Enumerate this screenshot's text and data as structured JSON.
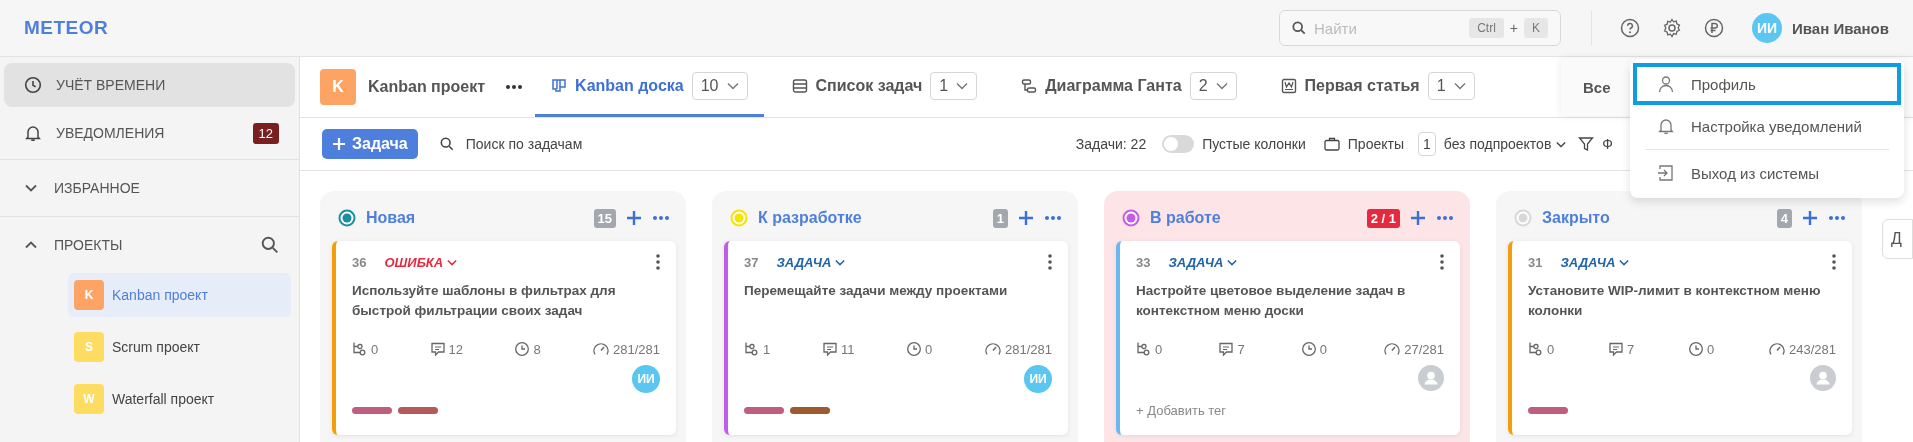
{
  "logo": "METEOR",
  "search": {
    "placeholder": "Найти",
    "keys": [
      "Ctrl",
      "+",
      "K"
    ]
  },
  "user": {
    "initials": "ИИ",
    "name": "Иван Иванов"
  },
  "sidebar": {
    "items": [
      {
        "label": "УЧЁТ ВРЕМЕНИ",
        "kind": "clock",
        "selected": true
      },
      {
        "label": "УВЕДОМЛЕНИЯ",
        "kind": "bell",
        "badge": "12",
        "selected": false
      }
    ],
    "sections": [
      {
        "label": "ИЗБРАННОЕ",
        "expanded": false,
        "searchable": false
      },
      {
        "label": "ПРОЕКТЫ",
        "expanded": true,
        "searchable": true,
        "projects": [
          {
            "letter": "K",
            "name": "Kanban проект",
            "color": "#fda465",
            "selected": true
          },
          {
            "letter": "S",
            "name": "Scrum проект",
            "color": "#fedc62",
            "selected": false
          },
          {
            "letter": "W",
            "name": "Waterfall проект",
            "color": "#fedc62",
            "selected": false
          }
        ]
      }
    ]
  },
  "project": {
    "letter": "K",
    "name": "Kanban проект",
    "color": "#fda465"
  },
  "tabs": [
    {
      "label": "Kanban доска",
      "kind": "board",
      "count": "10",
      "selected": true
    },
    {
      "label": "Список задач",
      "kind": "list",
      "count": "1",
      "selected": false
    },
    {
      "label": "Диаграмма Ганта",
      "kind": "gantt",
      "count": "2",
      "selected": false
    },
    {
      "label": "Первая статья",
      "kind": "article",
      "count": "1",
      "selected": false
    }
  ],
  "view_field": {
    "value": "Все"
  },
  "toolbar": {
    "add_button": "Задача",
    "search_placeholder": "Поиск по задачам",
    "tasks_count": "Задачи: 22",
    "empty_columns": {
      "label": "Пустые колонки",
      "on": false
    },
    "projects": {
      "label": "Проекты",
      "count": "1",
      "scope": "без подпроектов"
    },
    "filter_label": "Ф"
  },
  "user_menu": [
    {
      "label": "Профиль",
      "kind": "person",
      "selected": true
    },
    {
      "label": "Настройка уведомлений",
      "kind": "bell",
      "selected": false
    },
    {
      "label": "Выход из системы",
      "kind": "exit",
      "selected": false
    }
  ],
  "columns": [
    {
      "title": "Новая",
      "color": "#1a8fa0",
      "count": "15",
      "over_limit": false,
      "cards": [
        {
          "number": "36",
          "type": "ОШИБКА",
          "kind": "bug",
          "color": "#f59e0b",
          "title": "Используйте шаблоны в фильтрах для быстрой фильтрации своих задач",
          "subtasks": "0",
          "comments": "12",
          "time": "8",
          "estimate": "281/281",
          "assignee": {
            "kind": "initials",
            "initials": "ИИ"
          },
          "tags": [
            {
              "color": "#bf5f7d"
            },
            {
              "color": "#b45a5a"
            }
          ]
        }
      ]
    },
    {
      "title": "К разработке",
      "color": "#f5e400",
      "count": "1",
      "over_limit": false,
      "cards": [
        {
          "number": "37",
          "type": "ЗАДАЧА",
          "kind": "task",
          "color": "#c45ce8",
          "title": "Перемещайте задачи между проектами",
          "subtasks": "1",
          "comments": "11",
          "time": "0",
          "estimate": "281/281",
          "assignee": {
            "kind": "initials",
            "initials": "ИИ"
          },
          "tags": [
            {
              "color": "#bf5f7d"
            },
            {
              "color": "#9c5a2e"
            }
          ]
        }
      ]
    },
    {
      "title": "В работе",
      "color": "#c45ce8",
      "count": "2 / 1",
      "over_limit": true,
      "cards": [
        {
          "number": "33",
          "type": "ЗАДАЧА",
          "kind": "task",
          "color": "#6bb8f0",
          "title": "Настройте цветовое выделение задач в контекстном меню доски",
          "subtasks": "0",
          "comments": "7",
          "time": "0",
          "estimate": "27/281",
          "assignee": {
            "kind": "placeholder"
          },
          "add_tag": "+ Добавить тег"
        }
      ]
    },
    {
      "title": "Закрыто",
      "color": "#d8d8d8",
      "count": "4",
      "over_limit": false,
      "cards": [
        {
          "number": "31",
          "type": "ЗАДАЧА",
          "kind": "task",
          "color": "#f59e0b",
          "title": "Установите WIP-лимит в контекстном меню колонки",
          "subtasks": "0",
          "comments": "7",
          "time": "0",
          "estimate": "243/281",
          "assignee": {
            "kind": "placeholder"
          },
          "tags": [
            {
              "color": "#bf5f7d"
            }
          ]
        }
      ]
    }
  ],
  "side_field": {
    "value": "Д"
  }
}
